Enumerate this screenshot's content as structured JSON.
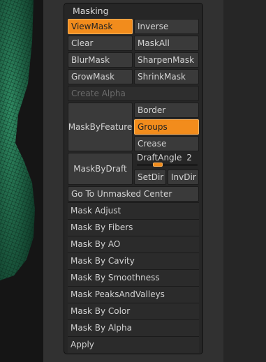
{
  "panel": {
    "title": "Masking",
    "buttons": {
      "viewmask": "ViewMask",
      "inverse": "Inverse",
      "clear": "Clear",
      "maskall": "MaskAll",
      "blurmask": "BlurMask",
      "sharpenmask": "SharpenMask",
      "growmask": "GrowMask",
      "shrinkmask": "ShrinkMask",
      "create_alpha": "Create Alpha",
      "maskbyfeature": "MaskByFeature",
      "border": "Border",
      "groups": "Groups",
      "crease": "Crease",
      "maskbydraft": "MaskByDraft",
      "setdir": "SetDir",
      "invdir": "InvDir",
      "go_to_unmasked": "Go To Unmasked Center"
    },
    "draftangle": {
      "label": "DraftAngle",
      "value": "2",
      "fraction": 0.35
    },
    "subpalettes": [
      "Mask Adjust",
      "Mask By Fibers",
      "Mask By AO",
      "Mask By Cavity",
      "Mask By Smoothness",
      "Mask PeaksAndValleys",
      "Mask By Color",
      "Mask By Alpha",
      "Apply"
    ],
    "colors": {
      "accent": "#f28c1c",
      "model": "#1f6b4a"
    }
  }
}
